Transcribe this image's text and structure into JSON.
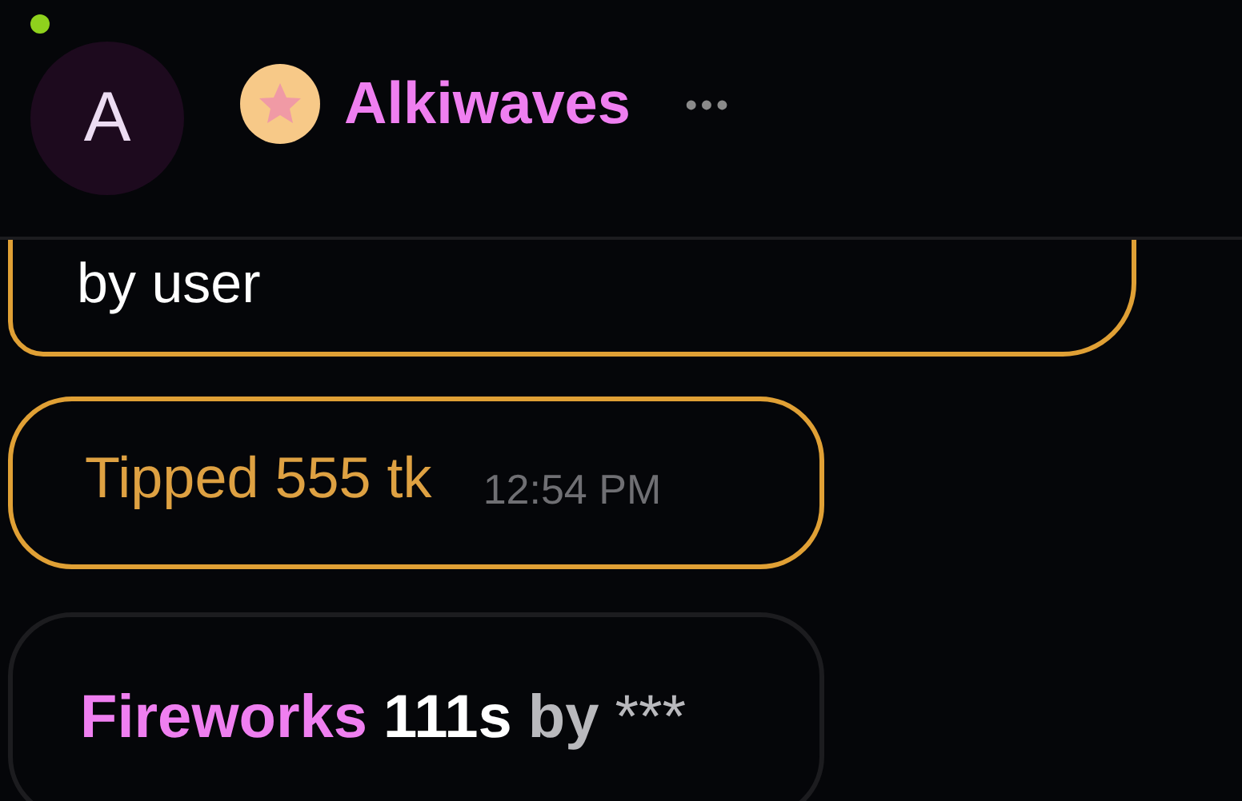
{
  "header": {
    "avatar_letter": "A",
    "online": true,
    "name": "Alkiwaves",
    "more": "•••"
  },
  "messages": [
    {
      "kind": "text",
      "text": "by user"
    },
    {
      "kind": "tip",
      "text": "Tipped 555 tk",
      "time": "12:54 PM"
    },
    {
      "kind": "gift",
      "gift": "Fireworks",
      "duration": "111s",
      "by": "by",
      "sender": "***"
    }
  ]
}
